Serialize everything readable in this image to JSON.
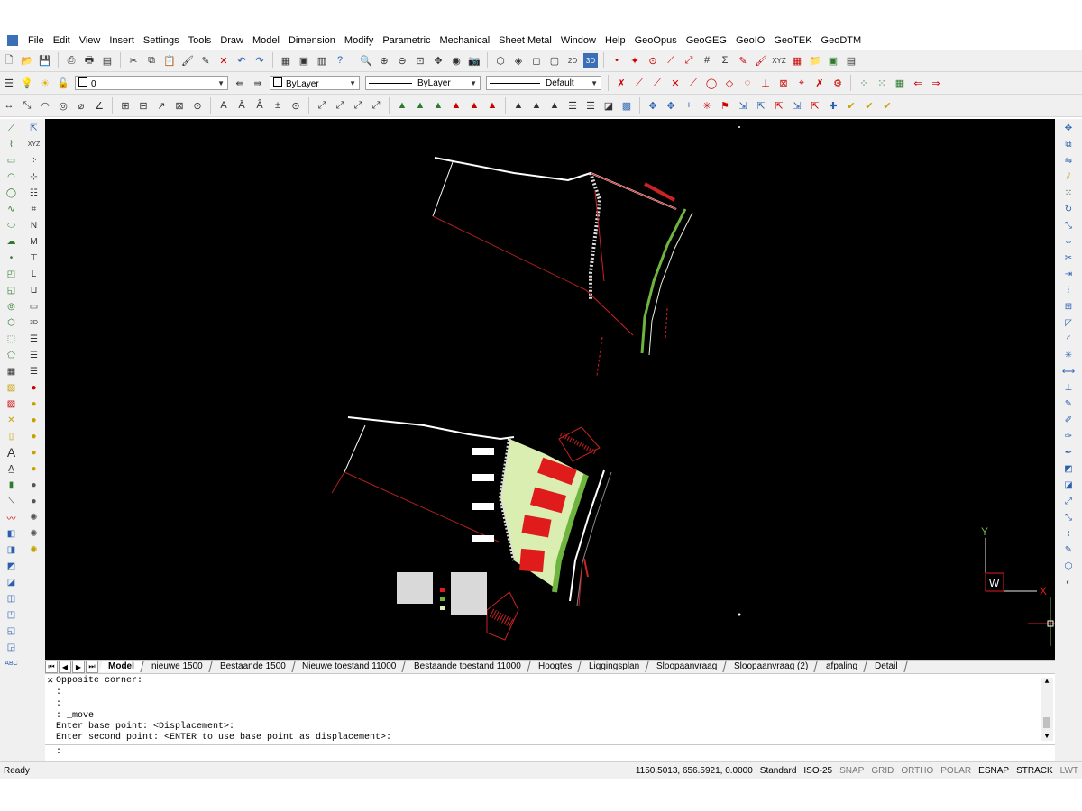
{
  "menu": [
    "File",
    "Edit",
    "View",
    "Insert",
    "Settings",
    "Tools",
    "Draw",
    "Model",
    "Dimension",
    "Modify",
    "Parametric",
    "Mechanical",
    "Sheet Metal",
    "Window",
    "Help",
    "GeoOpus",
    "GeoGEG",
    "GeoIO",
    "GeoTEK",
    "GeoDTM"
  ],
  "props": {
    "layer": "0",
    "color": "ByLayer",
    "linetype": "ByLayer",
    "lineweight": "Default"
  },
  "tabs": [
    "Model",
    "nieuwe 1500",
    "Bestaande 1500",
    "Nieuwe toestand 11000",
    "Bestaande toestand 11000",
    "Hoogtes",
    "Liggingsplan",
    "Sloopaanvraag",
    "Sloopaanvraag (2)",
    "afpaling",
    "Detail"
  ],
  "ucs": {
    "y": "Y",
    "x": "X",
    "w": "W"
  },
  "command": {
    "history": [
      "Opposite corner:",
      ":",
      ":",
      ": _move",
      "Enter base point: <Displacement>:",
      "Enter second point: <ENTER to use base point as displacement>:"
    ],
    "prompt": ":"
  },
  "status": {
    "ready": "Ready",
    "coords": "1150.5013, 656.5921, 0.0000",
    "style": "Standard",
    "dimstyle": "ISO-25",
    "toggles": [
      {
        "label": "SNAP",
        "on": false
      },
      {
        "label": "GRID",
        "on": false
      },
      {
        "label": "ORTHO",
        "on": false
      },
      {
        "label": "POLAR",
        "on": false
      },
      {
        "label": "ESNAP",
        "on": true
      },
      {
        "label": "STRACK",
        "on": true
      },
      {
        "label": "LWT",
        "on": false
      }
    ]
  },
  "colors": {
    "canvas": "#000000",
    "red": "#e01b1b",
    "green": "#6fb43f",
    "lightgreen": "#d9eeb0",
    "ui": "#f0f0f0"
  }
}
